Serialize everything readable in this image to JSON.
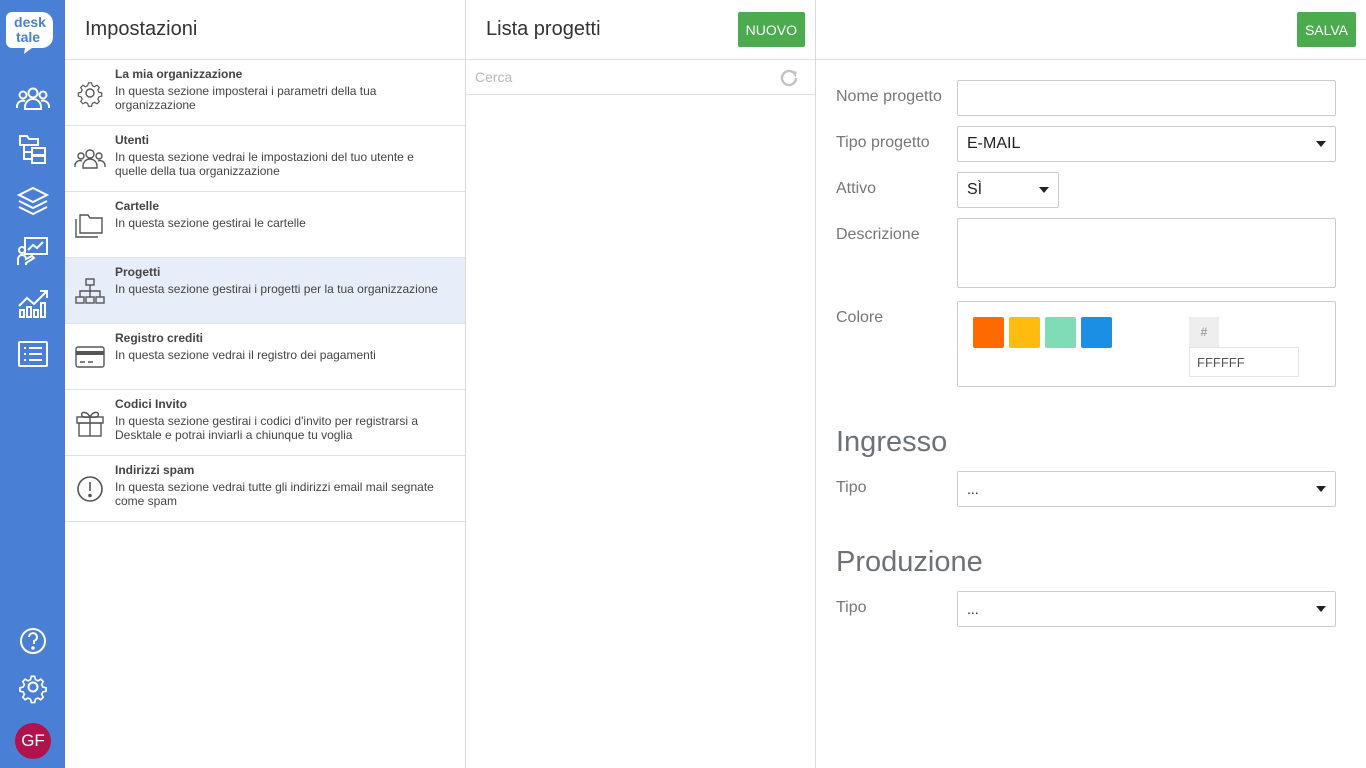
{
  "rail": {
    "logo_line1": "desk",
    "logo_line2": "tale",
    "items": [
      {
        "icon": "users-icon"
      },
      {
        "icon": "folder-tree-icon"
      },
      {
        "icon": "layers-icon"
      },
      {
        "icon": "presentation-icon"
      },
      {
        "icon": "analytics-icon"
      },
      {
        "icon": "list-icon"
      }
    ],
    "bottom": [
      {
        "icon": "help-icon"
      },
      {
        "icon": "gear-icon"
      }
    ],
    "avatar_initials": "GF"
  },
  "settings": {
    "title": "Impostazioni",
    "items": [
      {
        "icon": "gear-icon",
        "title": "La mia organizzazione",
        "desc": "In questa sezione imposterai i parametri della tua organizzazione"
      },
      {
        "icon": "users-icon",
        "title": "Utenti",
        "desc": "In questa sezione vedrai le impostazioni del tuo utente e quelle della tua organizzazione"
      },
      {
        "icon": "folders-icon",
        "title": "Cartelle",
        "desc": "In questa sezione gestirai le cartelle"
      },
      {
        "icon": "sitemap-icon",
        "title": "Progetti",
        "desc": "In questa sezione gestirai i progetti per la tua organizzazione"
      },
      {
        "icon": "credit-card-icon",
        "title": "Registro crediti",
        "desc": "In questa sezione vedrai il registro dei pagamenti"
      },
      {
        "icon": "gift-icon",
        "title": "Codici Invito",
        "desc": "In questa sezione gestirai i codici d'invito per registrarsi a Desktale e potrai inviarli a chiunque tu voglia"
      },
      {
        "icon": "alert-icon",
        "title": "Indirizzi spam",
        "desc": "In questa sezione vedrai tutte gli indirizzi email mail segnate come spam"
      }
    ],
    "active_index": 3
  },
  "project_list": {
    "title": "Lista progetti",
    "new_button": "NUOVO",
    "search_placeholder": "Cerca"
  },
  "form": {
    "save_button": "SALVA",
    "name_label": "Nome progetto",
    "name_value": "",
    "type_label": "Tipo progetto",
    "type_value": "E-MAIL",
    "active_label": "Attivo",
    "active_value": "SÌ",
    "description_label": "Descrizione",
    "description_value": "",
    "color_label": "Colore",
    "swatches": [
      "#ff6a00",
      "#ffbb0e",
      "#80dcb6",
      "#1a8fe3"
    ],
    "hash_symbol": "#",
    "hex_value": "FFFFFF",
    "ingress_title": "Ingresso",
    "ingress_type_label": "Tipo",
    "ingress_type_value": "...",
    "production_title": "Produzione",
    "production_type_label": "Tipo",
    "production_type_value": "..."
  }
}
